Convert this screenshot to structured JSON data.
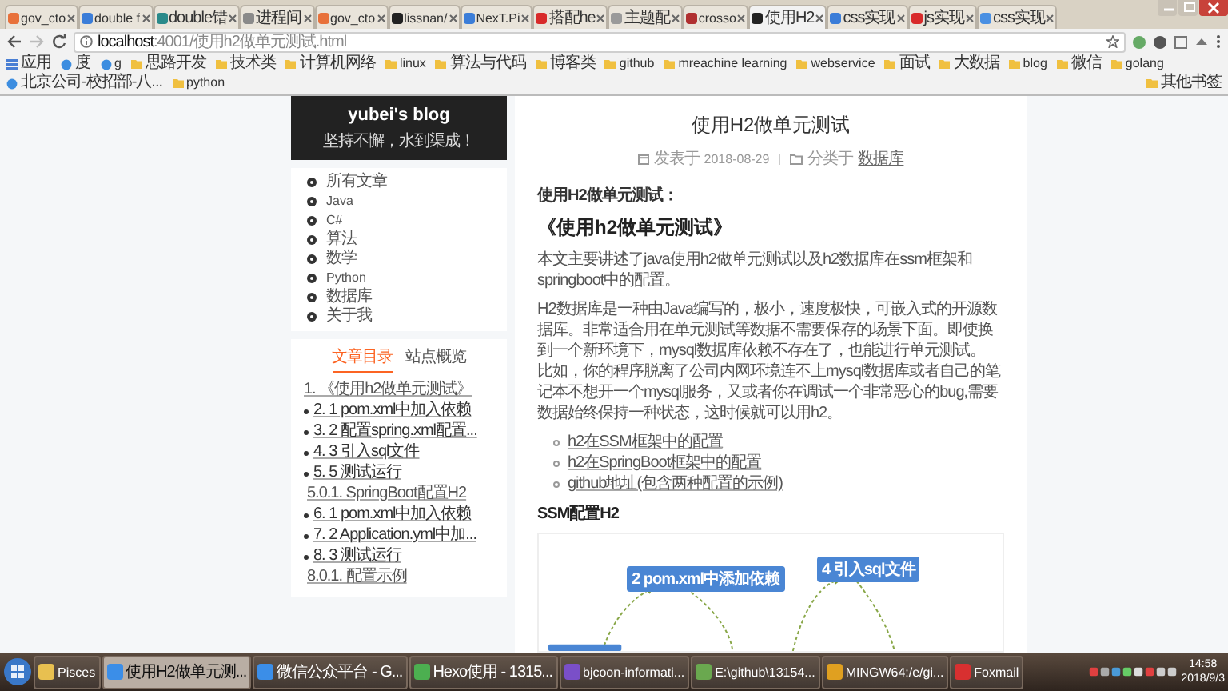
{
  "browser": {
    "tabs": [
      {
        "title": "gov_cto",
        "selected": false,
        "color": "#e8713a"
      },
      {
        "title": "double f",
        "selected": false,
        "color": "#3b7dd8"
      },
      {
        "title": "double错",
        "selected": false,
        "color": "#2a8a8a"
      },
      {
        "title": "进程间",
        "selected": false,
        "color": "#8a8a8a"
      },
      {
        "title": "gov_cto",
        "selected": false,
        "color": "#e8713a"
      },
      {
        "title": "lissnan/",
        "selected": false,
        "color": "#222222"
      },
      {
        "title": "NexT.Pi",
        "selected": false,
        "color": "#3b7dd8"
      },
      {
        "title": "搭配he",
        "selected": false,
        "color": "#d82a2a"
      },
      {
        "title": "主题配",
        "selected": false,
        "color": "#9a9a9a"
      },
      {
        "title": "crosso",
        "selected": false,
        "color": "#b03030"
      },
      {
        "title": "使用H2",
        "selected": true,
        "color": "#222222"
      },
      {
        "title": "css实现",
        "selected": false,
        "color": "#3b7dd8"
      },
      {
        "title": "js实现",
        "selected": false,
        "color": "#d82a2a"
      },
      {
        "title": "css实现",
        "selected": false,
        "color": "#4a90e2"
      }
    ],
    "address": {
      "host": "localhost",
      "path": ":4001/使用h2做单元测试.html"
    },
    "bookmarks": [
      {
        "kind": "apps",
        "label": "应用"
      },
      {
        "kind": "site",
        "label": "度"
      },
      {
        "kind": "site",
        "label": "g"
      },
      {
        "kind": "folder",
        "label": "思路开发"
      },
      {
        "kind": "folder",
        "label": "技术类"
      },
      {
        "kind": "folder",
        "label": "计算机网络"
      },
      {
        "kind": "folder",
        "label": "linux"
      },
      {
        "kind": "folder",
        "label": "算法与代码"
      },
      {
        "kind": "folder",
        "label": "博客类"
      },
      {
        "kind": "folder",
        "label": "github"
      },
      {
        "kind": "folder",
        "label": "mreachine learning"
      },
      {
        "kind": "folder",
        "label": "webservice"
      },
      {
        "kind": "folder",
        "label": "面试"
      },
      {
        "kind": "folder",
        "label": "大数据"
      },
      {
        "kind": "folder",
        "label": "blog"
      },
      {
        "kind": "folder",
        "label": "微信"
      },
      {
        "kind": "folder",
        "label": "golang"
      },
      {
        "kind": "site",
        "label": "北京公司-校招部-八..."
      },
      {
        "kind": "folder",
        "label": "python"
      },
      {
        "kind": "folder",
        "label": "其他书签"
      }
    ]
  },
  "sidebar": {
    "title": "yubei's blog",
    "subtitle": "坚持不懈，水到渠成！",
    "menu": [
      "所有文章",
      "Java",
      "C#",
      "算法",
      "数学",
      "Python",
      "数据库",
      "关于我"
    ],
    "toc_tabs": [
      {
        "label": "文章目录",
        "selected": true
      },
      {
        "label": "站点概览",
        "selected": false
      }
    ],
    "toc": [
      {
        "kind": "number",
        "text": "1. 《使用h2做单元测试》"
      },
      {
        "kind": "bullet",
        "text": "2. 1 pom.xml中加入依赖"
      },
      {
        "kind": "bullet",
        "text": "3. 2 配置spring.xml配置..."
      },
      {
        "kind": "bullet",
        "text": "4. 3 引入sql文件"
      },
      {
        "kind": "bullet",
        "text": "5. 5 测试运行",
        "children": [
          {
            "kind": "number",
            "text": "5.0.1. SpringBoot配置H2"
          }
        ]
      },
      {
        "kind": "bullet",
        "text": "6. 1 pom.xml中加入依赖"
      },
      {
        "kind": "bullet",
        "text": "7. 2 Application.yml中加..."
      },
      {
        "kind": "bullet",
        "text": "8. 3 测试运行",
        "children": [
          {
            "kind": "number",
            "text": "8.0.1. 配置示例"
          }
        ]
      }
    ]
  },
  "post": {
    "title": "使用H2做单元测试",
    "posted_label": "发表于",
    "date": "2018-08-29",
    "category_label": "分类于",
    "category": "数据库",
    "blocks": [
      {
        "kind": "strong",
        "text": "使用H2做单元测试："
      },
      {
        "kind": "h2",
        "text": "《使用h2做单元测试》"
      },
      {
        "kind": "p",
        "lines": [
          "本文主要讲述了java使用h2做单元测试以及h2数据库在ssm框架和springboot中的配置。"
        ]
      },
      {
        "kind": "p",
        "lines": [
          "H2数据库是一种由Java编写的，极小，速度极快，可嵌入式的开源数据库。非常适合用在单元测试等数据不需要保存的场景下面。即使换到一个新环境下，mysql数据库依赖不存在了，也能进行单元测试。",
          "比如，你的程序脱离了公司内网环境连不上mysql数据库或者自己的笔记本不想开一个mysql服务，又或者你在调试一个非常恶心的bug,需要数据始终保持一种状态，这时候就可以用h2。"
        ]
      },
      {
        "kind": "ul",
        "items": [
          "h2在SSM框架中的配置",
          "h2在SpringBoot框架中的配置",
          "github地址(包含两种配置的示例)"
        ]
      },
      {
        "kind": "h3",
        "text": "SSM配置H2"
      },
      {
        "kind": "diagram",
        "nodes": [
          "2 pom.xml中添加依赖",
          "4 引入sql文件"
        ]
      }
    ]
  },
  "taskbar": {
    "items": [
      {
        "label": "Pisces",
        "selected": false,
        "color": "#e8c050"
      },
      {
        "label": "使用H2做单元测...",
        "selected": true,
        "color": "#3b8ee8"
      },
      {
        "label": "微信公众平台 - G...",
        "selected": false,
        "color": "#3b8ee8"
      },
      {
        "label": "Hexo使用 - 1315...",
        "selected": false,
        "color": "#4caf50"
      },
      {
        "label": "bjcoon-informati...",
        "selected": false,
        "color": "#7a4fc8"
      },
      {
        "label": "E:\\github\\13154...",
        "selected": false,
        "color": "#6aa84f"
      },
      {
        "label": "MINGW64:/e/gi...",
        "selected": false,
        "color": "#e0a020"
      },
      {
        "label": "Foxmail",
        "selected": false,
        "color": "#d83030"
      }
    ],
    "time": "14:58",
    "date": "2018/9/3"
  }
}
